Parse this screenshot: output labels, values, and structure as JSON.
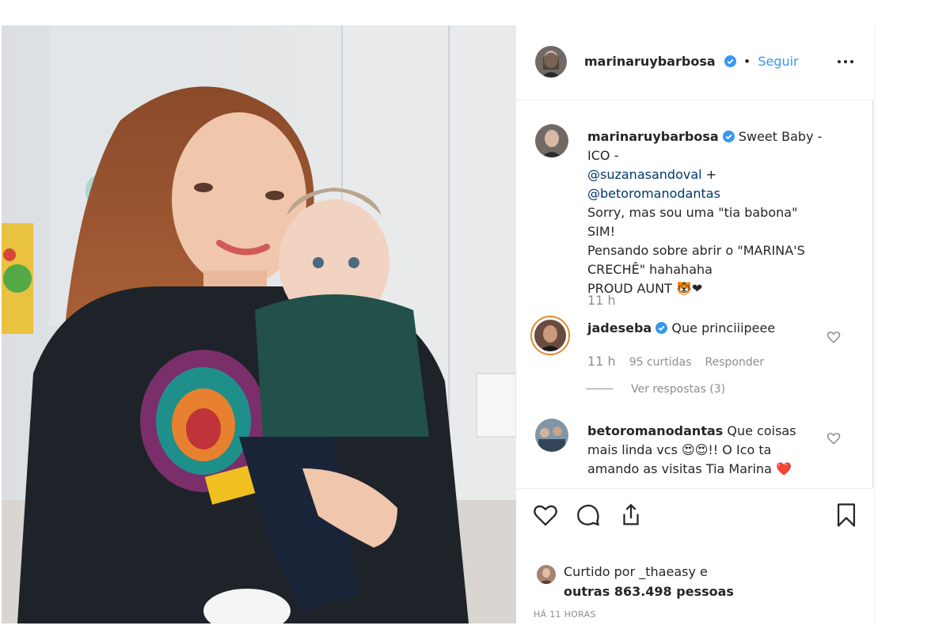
{
  "post": {
    "author": "marinaruybarbosa",
    "separator": "•",
    "follow_label": "Seguir",
    "more_icon": "more-options-icon"
  },
  "caption": {
    "author": "marinaruybarbosa",
    "line1": "Sweet Baby -",
    "line2": "ICO -",
    "mention1": "@suzanasandoval",
    "plus": "+",
    "mention2": "@betoromanodantas",
    "line3": "Sorry, mas sou uma \"tia babona\" SIM!",
    "line4": "Pensando sobre abrir o \"MARINA'S",
    "line5": "CRECHÊ\" hahahaha",
    "line6": "PROUD AUNT",
    "emoji_tiger": "🐯",
    "emoji_heart": "❤",
    "time": "11 h"
  },
  "comments": [
    {
      "author": "jadeseba",
      "text": "Que princiiipeee",
      "time": "11 h",
      "likes": "95 curtidas",
      "reply_label": "Responder",
      "view_replies": "Ver respostas (3)"
    },
    {
      "author": "betoromanodantas",
      "text_line1": "Que coisas",
      "text_line2": "mais linda vcs",
      "emoji_heart_eyes": "😍😍",
      "text_line3": "!! O Ico ta",
      "text_line4": "amando as visitas Tia Marina",
      "emoji_red_heart": "❤️"
    }
  ],
  "footer": {
    "liked_by_prefix": "Curtido por",
    "liked_by_user": "_thaeasy",
    "liked_by_suffix": "e",
    "others": "outras 863.498 pessoas",
    "timestamp": "HÁ 11 HORAS"
  },
  "colors": {
    "link": "#00376b",
    "follow": "#3897f0",
    "verified": "#3897f0",
    "muted": "#8e8e8e",
    "text": "#262626"
  }
}
